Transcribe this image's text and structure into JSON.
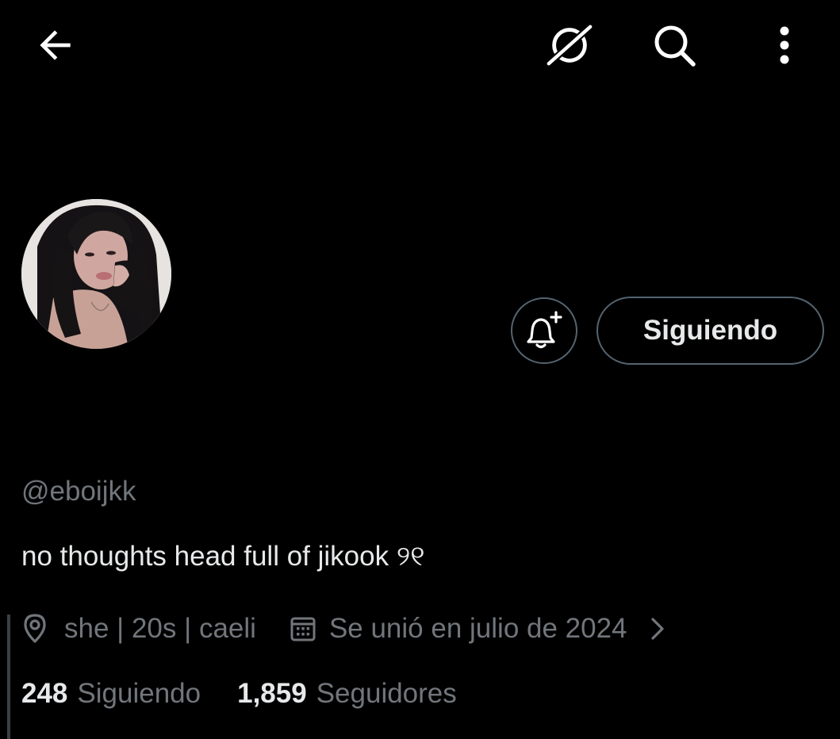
{
  "header": {
    "back_icon": "arrow-left-icon",
    "grok_icon": "grok-icon",
    "search_icon": "search-icon",
    "more_icon": "more-vertical-icon"
  },
  "profile": {
    "handle": "@eboijkk",
    "bio": "no thoughts head full of jikook ୨୧",
    "location": "she | 20s | caeli",
    "joined": "Se unió en julio de 2024"
  },
  "actions": {
    "notify_icon": "bell-plus-icon",
    "follow_label": "Siguiendo"
  },
  "stats": {
    "following_count": "248",
    "following_label": "Siguiendo",
    "followers_count": "1,859",
    "followers_label": "Seguidores"
  },
  "colors": {
    "background": "#000000",
    "text_primary": "#e7e9ea",
    "text_secondary": "#71767b",
    "border": "#536471"
  }
}
